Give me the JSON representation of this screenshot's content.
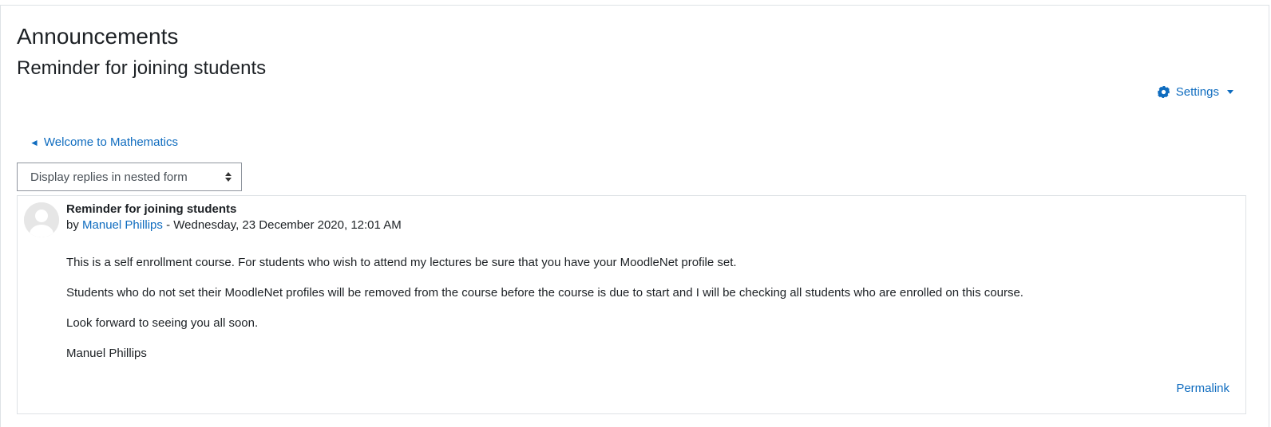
{
  "page": {
    "forum_title": "Announcements",
    "discussion_title": "Reminder for joining students"
  },
  "settings": {
    "label": "Settings",
    "icon": "gear-icon"
  },
  "navigation": {
    "previous_label": "Welcome to Mathematics",
    "previous_arrow": "◄"
  },
  "display_mode": {
    "selected": "Display replies in nested form"
  },
  "post": {
    "subject": "Reminder for joining students",
    "by_prefix": "by",
    "author": "Manuel Phillips",
    "date_separator": "-",
    "date": "Wednesday, 23 December 2020, 12:01 AM",
    "paragraphs": [
      "This is a self enrollment course. For students who wish to attend my lectures be sure that you have your MoodleNet profile set.",
      "Students who do not set their MoodleNet profiles will be  removed from the course before the course is due to start and I will be checking all students who are enrolled on this course.",
      "Look forward to seeing you all soon.",
      "Manuel Phillips"
    ],
    "permalink_label": "Permalink"
  },
  "colors": {
    "link": "#0f6cbf",
    "text": "#1d2125",
    "border": "#dee2e6"
  }
}
